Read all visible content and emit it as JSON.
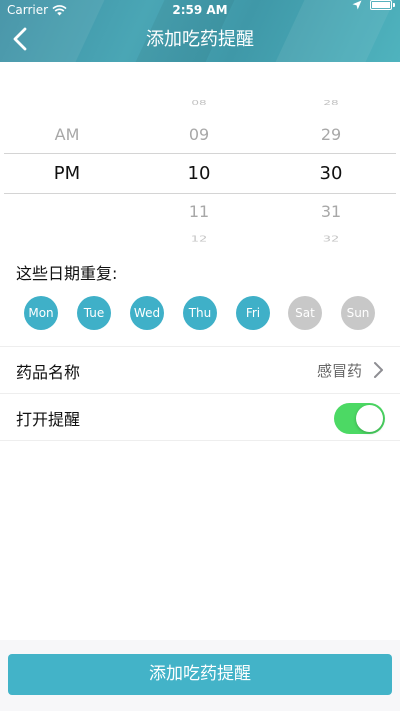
{
  "status_bar": {
    "carrier": "Carrier",
    "time": "2:59 AM"
  },
  "nav": {
    "title": "添加吃药提醒",
    "back_icon": "chevron-left-icon"
  },
  "picker": {
    "ampm": [
      "AM",
      "PM"
    ],
    "hours": [
      "08",
      "09",
      "10",
      "11",
      "12"
    ],
    "minutes": [
      "28",
      "29",
      "30",
      "31",
      "32"
    ],
    "selected": {
      "ampm": "PM",
      "hour": "10",
      "minute": "30"
    }
  },
  "repeat": {
    "label": "这些日期重复:",
    "days": [
      {
        "label": "Mon",
        "active": true
      },
      {
        "label": "Tue",
        "active": true
      },
      {
        "label": "Wed",
        "active": true
      },
      {
        "label": "Thu",
        "active": true
      },
      {
        "label": "Fri",
        "active": true
      },
      {
        "label": "Sat",
        "active": false
      },
      {
        "label": "Sun",
        "active": false
      }
    ]
  },
  "medicine": {
    "label": "药品名称",
    "value": "感冒药"
  },
  "reminder": {
    "label": "打开提醒",
    "enabled": true
  },
  "submit": {
    "label": "添加吃药提醒"
  },
  "colors": {
    "accent": "#3fb0c8",
    "day_inactive": "#c8c8c8",
    "toggle_on": "#4cd964",
    "button": "#43b3c8"
  }
}
